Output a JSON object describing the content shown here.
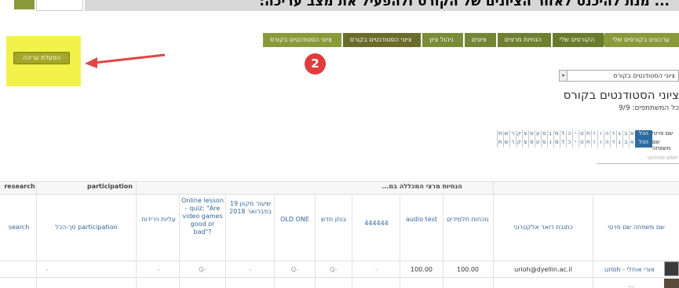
{
  "banner": {
    "heading": "... מנת להיכנס לאזור הציונים של הקורס ולהפעיל את מצב עריכה:"
  },
  "edit_button": {
    "label": "הפעלת עריכה"
  },
  "step_badge": "2",
  "breadcrumb": [
    "ערכונים בקורסים שלי",
    "הקורסים שלי",
    "הנחיות מרצים",
    "ציונים",
    "ניהול ציון",
    "ציוני הסטודנטים בקורס",
    "ציוני הסטודנטים בקורס"
  ],
  "group_select": {
    "value": "ציוני הסטודנטים בקורס"
  },
  "page_title": "ציוני הסטודנטים בקורס",
  "participants_text": "כל המשתתפים: 9/9",
  "filters": {
    "first_name_label": "שם פרטי",
    "last_name_label": "שם משפחה",
    "all_label": "הכל",
    "letters": [
      "א",
      "ב",
      "ג",
      "ד",
      "ה",
      "ו",
      "ז",
      "ח",
      "ט",
      "י",
      "כ",
      "ל",
      "מ",
      "נ",
      "ס",
      "ע",
      "פ",
      "צ",
      "ק",
      "ר",
      "ש",
      "ת"
    ]
  },
  "search_placeholder": "חפש סטודנט",
  "categories": {
    "research": "research",
    "participation": "participation",
    "main": "הנחיות מרצי המכללה במ..."
  },
  "columns": {
    "search": "search",
    "participation_total": "participation סך-הכל",
    "aliyot": "עליות וירידות",
    "online_lesson": "Online lesson - quiz: \"Are video games good or bad\"?",
    "makeup_lesson": "שיעור מקוון 19 בפברואר 2018",
    "old_one": "OLD ONE",
    "new_test": "בוחן חדש",
    "num_444444": "444444",
    "audio_test": "audio test",
    "student_notes": "נוכחות תלמידים",
    "email": "כתובת דואר אלקטרוני",
    "name": "שם משפחה שם פרטי"
  },
  "row": {
    "student_name": "אורי אוחלי - urioh",
    "email": "urioh@dyellin.ac.il",
    "student_notes": "100.00",
    "audio_test": "100.00",
    "num_444444": "-",
    "new_test": "Q-",
    "old_one": "Q-",
    "makeup": "-",
    "online": "Q-",
    "aliyot": "-",
    "participation": "-"
  },
  "row2_name": "..."
}
